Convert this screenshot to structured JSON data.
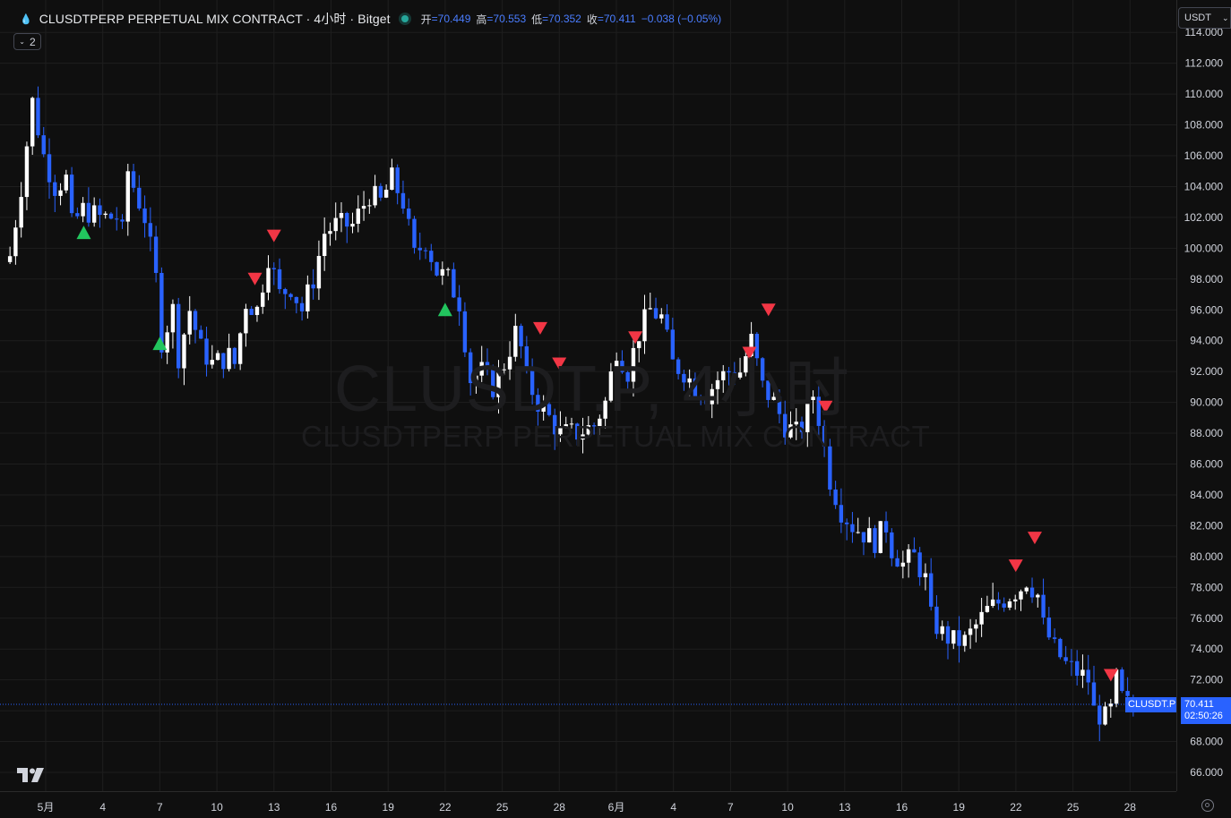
{
  "header": {
    "symbol_title": "CLUSDTPERP PERPETUAL MIX CONTRACT · 4小时 · Bitget",
    "ohlc": {
      "open_label": "开",
      "open_value": "=70.449",
      "high_label": "高",
      "high_value": "=70.553",
      "low_label": "低",
      "low_value": "=70.352",
      "close_label": "收",
      "close_value": "=70.411",
      "change": "−0.038 (−0.05%)"
    },
    "collapse_count": "2",
    "currency": "USDT"
  },
  "watermark": {
    "line1": "CLUSDT.P, 4小时",
    "line2": "CLUSDTPERP PERPETUAL MIX CONTRACT"
  },
  "price_tag": {
    "symbol": "CLUSDT.P",
    "price": "70.411",
    "countdown": "02:50:26"
  },
  "colors": {
    "up": "#ffffff",
    "down": "#2962ff",
    "buy_marker": "#22c55e",
    "sell_marker": "#f23645",
    "background": "#0f0f0f",
    "grid": "#1e1e1e"
  },
  "chart_data": {
    "type": "candlestick",
    "y_axis": {
      "range": [
        65.0,
        114.0
      ],
      "ticks": [
        "66.000",
        "68.000",
        "70.000",
        "72.000",
        "74.000",
        "76.000",
        "78.000",
        "80.000",
        "82.000",
        "84.000",
        "86.000",
        "88.000",
        "90.000",
        "92.000",
        "94.000",
        "96.000",
        "98.000",
        "100.000",
        "102.000",
        "104.000",
        "106.000",
        "108.000",
        "110.000",
        "112.000",
        "114.000"
      ]
    },
    "x_axis": {
      "ticks": [
        "5月",
        "4",
        "7",
        "10",
        "13",
        "16",
        "19",
        "22",
        "25",
        "28",
        "6月",
        "4",
        "7",
        "10",
        "13",
        "16",
        "19",
        "22",
        "25",
        "28"
      ]
    },
    "grid": true,
    "close_path": [
      [
        0,
        99.5
      ],
      [
        2,
        104.0
      ],
      [
        4,
        109.5
      ],
      [
        6,
        106.0
      ],
      [
        8,
        104.0
      ],
      [
        10,
        104.5
      ],
      [
        11,
        101.5
      ],
      [
        13,
        102.5
      ],
      [
        16,
        102.0
      ],
      [
        19,
        102.0
      ],
      [
        20,
        101.0
      ],
      [
        21,
        105.0
      ],
      [
        22,
        104.0
      ],
      [
        24,
        102.0
      ],
      [
        26,
        98.0
      ],
      [
        27,
        94.0
      ],
      [
        29,
        96.0
      ],
      [
        30,
        93.0
      ],
      [
        32,
        96.0
      ],
      [
        34,
        93.5
      ],
      [
        36,
        92.5
      ],
      [
        39,
        93.0
      ],
      [
        40,
        92.5
      ],
      [
        42,
        96.5
      ],
      [
        44,
        96.0
      ],
      [
        46,
        99.5
      ],
      [
        48,
        97.0
      ],
      [
        50,
        97.5
      ],
      [
        52,
        96.0
      ],
      [
        54,
        98.0
      ],
      [
        56,
        101.0
      ],
      [
        58,
        101.5
      ],
      [
        61,
        101.5
      ],
      [
        64,
        103.5
      ],
      [
        66,
        103.0
      ],
      [
        68,
        104.5
      ],
      [
        70,
        103.0
      ],
      [
        72,
        99.5
      ],
      [
        74,
        100.5
      ],
      [
        76,
        98.5
      ],
      [
        78,
        98.0
      ],
      [
        80,
        96.5
      ],
      [
        82,
        91.5
      ],
      [
        84,
        92.0
      ],
      [
        86,
        91.0
      ],
      [
        88,
        92.5
      ],
      [
        90,
        94.5
      ],
      [
        91,
        93.5
      ],
      [
        92,
        91.5
      ],
      [
        94,
        90.0
      ],
      [
        96,
        89.0
      ],
      [
        98,
        88.0
      ],
      [
        101,
        88.0
      ],
      [
        104,
        88.5
      ],
      [
        106,
        90.0
      ],
      [
        108,
        93.5
      ],
      [
        110,
        92.0
      ],
      [
        112,
        94.5
      ],
      [
        114,
        96.0
      ],
      [
        116,
        95.5
      ],
      [
        118,
        92.5
      ],
      [
        120,
        92.0
      ],
      [
        122,
        91.0
      ],
      [
        124,
        90.5
      ],
      [
        126,
        91.5
      ],
      [
        128,
        92.0
      ],
      [
        130,
        92.0
      ],
      [
        132,
        94.0
      ],
      [
        134,
        91.0
      ],
      [
        136,
        90.0
      ],
      [
        138,
        88.5
      ],
      [
        140,
        88.0
      ],
      [
        141,
        88.5
      ],
      [
        143,
        90.5
      ],
      [
        144,
        89.0
      ],
      [
        146,
        85.0
      ],
      [
        148,
        83.0
      ],
      [
        150,
        82.0
      ],
      [
        152,
        81.5
      ],
      [
        154,
        81.0
      ],
      [
        156,
        82.0
      ],
      [
        157,
        80.5
      ],
      [
        159,
        79.5
      ],
      [
        161,
        80.0
      ],
      [
        163,
        78.5
      ],
      [
        164,
        76.0
      ],
      [
        166,
        75.0
      ],
      [
        168,
        74.5
      ],
      [
        170,
        74.5
      ],
      [
        172,
        75.5
      ],
      [
        174,
        76.5
      ],
      [
        176,
        77.0
      ],
      [
        178,
        77.5
      ],
      [
        180,
        78.0
      ],
      [
        181,
        78.5
      ],
      [
        183,
        77.5
      ],
      [
        184,
        75.5
      ],
      [
        186,
        74.0
      ],
      [
        188,
        73.0
      ],
      [
        190,
        72.5
      ],
      [
        192,
        72.0
      ],
      [
        193,
        70.0
      ],
      [
        195,
        69.5
      ],
      [
        196,
        70.0
      ],
      [
        197,
        72.0
      ],
      [
        198,
        70.8
      ],
      [
        199,
        70.4
      ],
      [
        200,
        70.411
      ]
    ],
    "markers": [
      {
        "type": "buy",
        "x": "5月3",
        "price": 101.0
      },
      {
        "type": "buy",
        "x": "5月7",
        "price": 93.8
      },
      {
        "type": "sell",
        "x": "5月12",
        "price": 98.0
      },
      {
        "type": "sell",
        "x": "5月13",
        "price": 100.8
      },
      {
        "type": "buy",
        "x": "5月22",
        "price": 96.0
      },
      {
        "type": "sell",
        "x": "5月27",
        "price": 94.8
      },
      {
        "type": "sell",
        "x": "5月28",
        "price": 92.5
      },
      {
        "type": "sell",
        "x": "6月1",
        "price": 94.2
      },
      {
        "type": "sell",
        "x": "6月7",
        "price": 93.2
      },
      {
        "type": "sell",
        "x": "6月8",
        "price": 96.0
      },
      {
        "type": "sell",
        "x": "6月11",
        "price": 89.7
      },
      {
        "type": "sell",
        "x": "6月21",
        "price": 79.4
      },
      {
        "type": "sell",
        "x": "6月22",
        "price": 81.2
      },
      {
        "type": "sell",
        "x": "6月26",
        "price": 72.3
      }
    ],
    "last_price": 70.411
  }
}
